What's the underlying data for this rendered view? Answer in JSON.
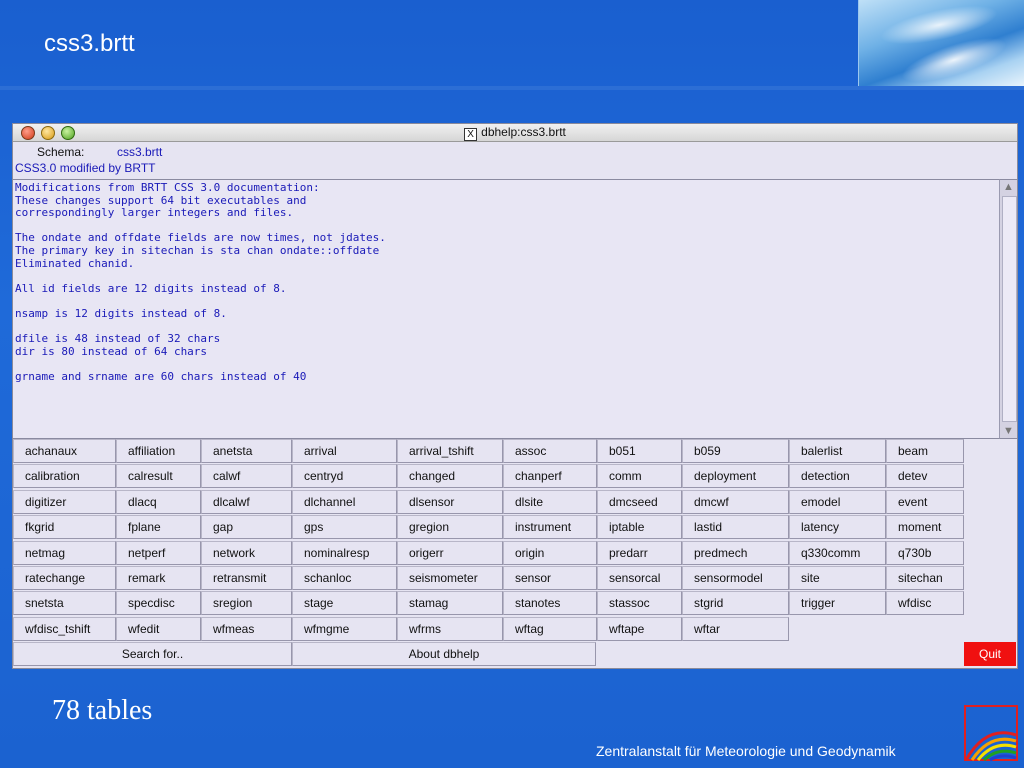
{
  "slide": {
    "title": "css3.brtt",
    "caption": "78 tables",
    "footer": "Zentralanstalt für Meteorologie und Geodynamik"
  },
  "window": {
    "title": "dbhelp:css3.brtt",
    "close_glyph": "X",
    "schema_label": "Schema:",
    "schema_value": "css3.brtt",
    "description": "CSS3.0 modified by BRTT",
    "text_lines": [
      "Modifications from BRTT CSS 3.0 documentation:",
      "These changes support 64 bit executables and",
      "correspondingly larger integers and files.",
      "",
      "The ondate and offdate fields are now times, not jdates.",
      "The primary key in sitechan is sta chan ondate::offdate",
      "Eliminated chanid.",
      "",
      "All id fields are 12 digits instead of 8.",
      "",
      "nsamp is 12 digits instead of 8.",
      "",
      "dfile is 48 instead of 32 chars",
      "dir is 80 instead of 64 chars",
      "",
      "grname and srname are 60 chars instead of 40"
    ]
  },
  "tables": [
    [
      "achanaux",
      "affiliation",
      "anetsta",
      "arrival",
      "arrival_tshift",
      "assoc",
      "b051",
      "b059",
      "balerlist",
      "beam"
    ],
    [
      "calibration",
      "calresult",
      "calwf",
      "centryd",
      "changed",
      "chanperf",
      "comm",
      "deployment",
      "detection",
      "detev"
    ],
    [
      "digitizer",
      "dlacq",
      "dlcalwf",
      "dlchannel",
      "dlsensor",
      "dlsite",
      "dmcseed",
      "dmcwf",
      "emodel",
      "event"
    ],
    [
      "fkgrid",
      "fplane",
      "gap",
      "gps",
      "gregion",
      "instrument",
      "iptable",
      "lastid",
      "latency",
      "moment"
    ],
    [
      "netmag",
      "netperf",
      "network",
      "nominalresp",
      "origerr",
      "origin",
      "predarr",
      "predmech",
      "q330comm",
      "q730b"
    ],
    [
      "ratechange",
      "remark",
      "retransmit",
      "schanloc",
      "seismometer",
      "sensor",
      "sensorcal",
      "sensormodel",
      "site",
      "sitechan"
    ],
    [
      "snetsta",
      "specdisc",
      "sregion",
      "stage",
      "stamag",
      "stanotes",
      "stassoc",
      "stgrid",
      "trigger",
      "wfdisc"
    ],
    [
      "wfdisc_tshift",
      "wfedit",
      "wfmeas",
      "wfmgme",
      "wfrms",
      "wftag",
      "wftape",
      "wftar"
    ]
  ],
  "buttons": {
    "search": "Search for..",
    "about": "About dbhelp",
    "quit": "Quit"
  },
  "colors": {
    "slide_bg": "#1b62d0",
    "window_bg": "#e6e4f2",
    "text_blue": "#1a1ab8",
    "quit_red": "#f01010"
  }
}
